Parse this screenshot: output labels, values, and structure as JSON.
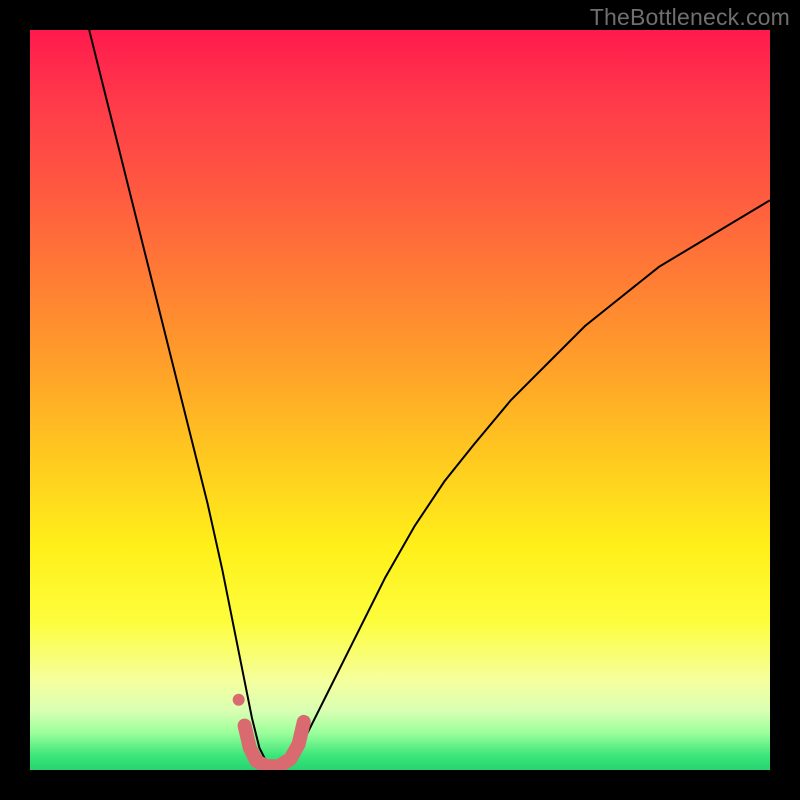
{
  "watermark": "TheBottleneck.com",
  "chart_data": {
    "type": "line",
    "title": "",
    "xlabel": "",
    "ylabel": "",
    "xlim": [
      0,
      100
    ],
    "ylim": [
      0,
      100
    ],
    "series": [
      {
        "name": "black-v-curve",
        "stroke": "#000000",
        "width": 2,
        "x": [
          8,
          10,
          12,
          14,
          16,
          18,
          20,
          22,
          24,
          26,
          27,
          28,
          29,
          30,
          31,
          32,
          33,
          34,
          35,
          37,
          40,
          44,
          48,
          52,
          56,
          60,
          65,
          70,
          75,
          80,
          85,
          90,
          95,
          100
        ],
        "y": [
          100,
          92,
          84,
          76,
          68,
          60,
          52,
          44,
          36,
          27,
          22,
          17,
          12,
          7,
          3,
          1,
          0,
          0,
          1,
          4,
          10,
          18,
          26,
          33,
          39,
          44,
          50,
          55,
          60,
          64,
          68,
          71,
          74,
          77
        ]
      },
      {
        "name": "pink-marker-segment",
        "stroke": "#d86a70",
        "width": 14,
        "linecap": "round",
        "x": [
          29.0,
          29.7,
          30.6,
          32.0,
          33.6,
          35.2,
          36.3,
          37.0
        ],
        "y": [
          6.0,
          3.0,
          1.2,
          0.5,
          0.5,
          1.5,
          3.5,
          6.5
        ]
      },
      {
        "name": "pink-dot",
        "stroke": "#d86a70",
        "type": "scatter",
        "x": [
          28.2
        ],
        "y": [
          9.5
        ],
        "r": 6
      }
    ]
  }
}
